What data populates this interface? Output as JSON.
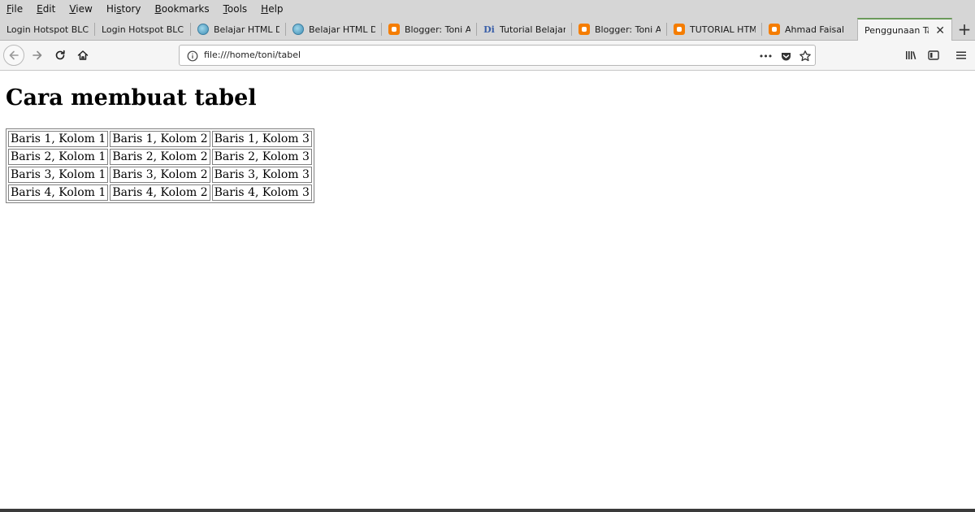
{
  "menubar": {
    "items": [
      {
        "label": "File",
        "accel": "F",
        "rest": "ile"
      },
      {
        "label": "Edit",
        "accel": "E",
        "rest": "dit"
      },
      {
        "label": "View",
        "accel": "V",
        "rest": "iew"
      },
      {
        "label": "History",
        "accel": "S",
        "pre": "Hi",
        "rest": "tory"
      },
      {
        "label": "Bookmarks",
        "accel": "B",
        "rest": "ookmarks"
      },
      {
        "label": "Tools",
        "accel": "T",
        "rest": "ools"
      },
      {
        "label": "Help",
        "accel": "H",
        "rest": "elp"
      }
    ]
  },
  "tabs": [
    {
      "label": "Login Hotspot BLC T",
      "favicon": "none"
    },
    {
      "label": "Login Hotspot BLC T",
      "favicon": "none"
    },
    {
      "label": "Belajar HTML Da",
      "favicon": "globe-icon"
    },
    {
      "label": "Belajar HTML Da",
      "favicon": "globe-icon"
    },
    {
      "label": "Blogger: Toni An",
      "favicon": "blogger-icon"
    },
    {
      "label": "Tutorial Belajar",
      "favicon": "di-icon",
      "favicon_text": "Di"
    },
    {
      "label": "Blogger: Toni An",
      "favicon": "blogger-icon"
    },
    {
      "label": "TUTORIAL HTML",
      "favicon": "blogger-icon"
    },
    {
      "label": "Ahmad Faisal",
      "favicon": "blogger-icon"
    },
    {
      "label": "Penggunaan Tag",
      "favicon": "none",
      "active": true
    }
  ],
  "newtab_symbol": "+",
  "tab_close_symbol": "✕",
  "urlbar": {
    "url": "file:///home/toni/tabel",
    "page_actions_symbol": "•••"
  },
  "page": {
    "title": "Cara membuat tabel",
    "table": {
      "rows": [
        [
          "Baris 1, Kolom 1",
          "Baris 1, Kolom 2",
          "Baris 1, Kolom 3"
        ],
        [
          "Baris 2, Kolom 1",
          "Baris 2, Kolom 2",
          "Baris 2, Kolom 3"
        ],
        [
          "Baris 3, Kolom 1",
          "Baris 3, Kolom 2",
          "Baris 3, Kolom 3"
        ],
        [
          "Baris 4, Kolom 1",
          "Baris 4, Kolom 2",
          "Baris 4, Kolom 3"
        ]
      ]
    }
  },
  "colors": {
    "chrome_bg": "#d6d6d6",
    "toolbar_bg": "#f5f5f5",
    "active_tab_accent": "#6b9a5b",
    "blogger_orange": "#f57d00"
  }
}
